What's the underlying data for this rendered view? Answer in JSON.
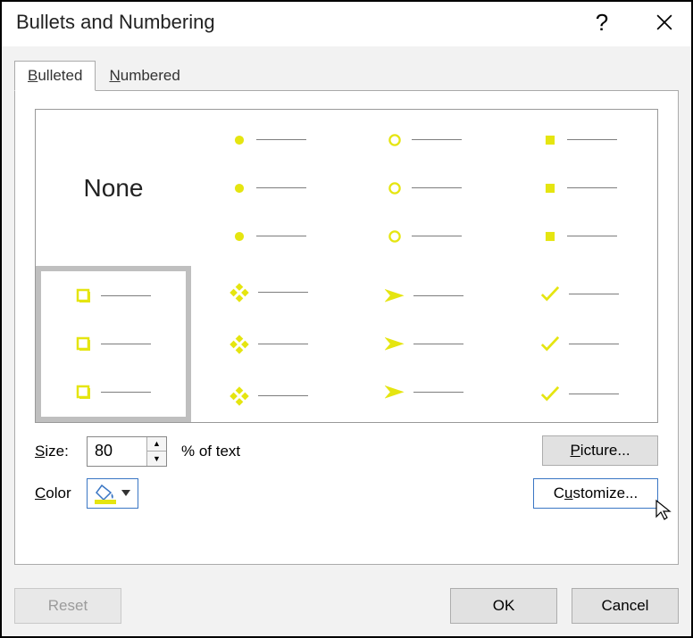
{
  "dialog": {
    "title": "Bullets and Numbering"
  },
  "tabs": {
    "bulleted": "Bulleted",
    "numbered": "Numbered",
    "active": "bulleted"
  },
  "grid": {
    "none_label": "None",
    "selected_index": 4,
    "styles": [
      {
        "id": "none",
        "kind": "none"
      },
      {
        "id": "solid-dot",
        "kind": "bullet"
      },
      {
        "id": "hollow-circle",
        "kind": "bullet"
      },
      {
        "id": "solid-square",
        "kind": "bullet"
      },
      {
        "id": "hollow-square",
        "kind": "bullet"
      },
      {
        "id": "four-diamond",
        "kind": "bullet"
      },
      {
        "id": "arrowhead",
        "kind": "bullet"
      },
      {
        "id": "checkmark",
        "kind": "bullet"
      }
    ]
  },
  "size": {
    "label": "Size:",
    "value": "80",
    "suffix": "% of text"
  },
  "color": {
    "label": "Color",
    "value": "#e5e510"
  },
  "buttons": {
    "picture": "Picture...",
    "customize": "Customize...",
    "reset": "Reset",
    "ok": "OK",
    "cancel": "Cancel"
  }
}
